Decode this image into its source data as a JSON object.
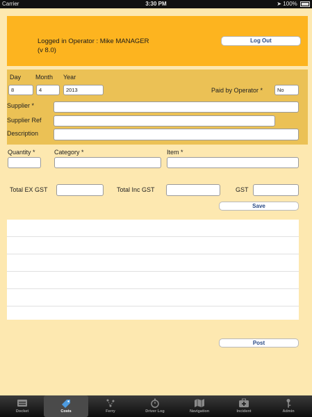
{
  "status_bar": {
    "carrier": "Carrier",
    "time": "3:30 PM",
    "battery": "100%"
  },
  "header": {
    "operator_line": "Logged in Operator : Mike MANAGER",
    "version": "(v 8.0)",
    "logout_label": "Log Out"
  },
  "date": {
    "day_label": "Day",
    "month_label": "Month",
    "year_label": "Year",
    "day_value": "8",
    "month_value": "4",
    "year_value": "2013"
  },
  "paid_by_operator": {
    "label": "Paid by Operator *",
    "value": "No"
  },
  "supplier": {
    "label": "Supplier *",
    "value": ""
  },
  "supplier_ref": {
    "label": "Supplier Ref",
    "value": ""
  },
  "description": {
    "label": "Description",
    "value": ""
  },
  "quantity": {
    "label": "Quantity *",
    "value": ""
  },
  "category": {
    "label": "Category *",
    "value": ""
  },
  "item": {
    "label": "Item *",
    "value": ""
  },
  "totals": {
    "ex_gst_label": "Total EX GST",
    "ex_gst_value": "",
    "inc_gst_label": "Total Inc GST",
    "inc_gst_value": "",
    "gst_label": "GST",
    "gst_value": ""
  },
  "save_label": "Save",
  "post_label": "Post",
  "tabs": [
    {
      "label": "Docket",
      "icon": "docket-icon",
      "active": false
    },
    {
      "label": "Costs",
      "icon": "costs-tag-icon",
      "active": true
    },
    {
      "label": "Ferry",
      "icon": "ferry-icon",
      "active": false
    },
    {
      "label": "Driver Log",
      "icon": "stopwatch-icon",
      "active": false
    },
    {
      "label": "Navigation",
      "icon": "map-icon",
      "active": false
    },
    {
      "label": "Incident",
      "icon": "first-aid-icon",
      "active": false
    },
    {
      "label": "Admin",
      "icon": "admin-key-icon",
      "active": false
    }
  ]
}
